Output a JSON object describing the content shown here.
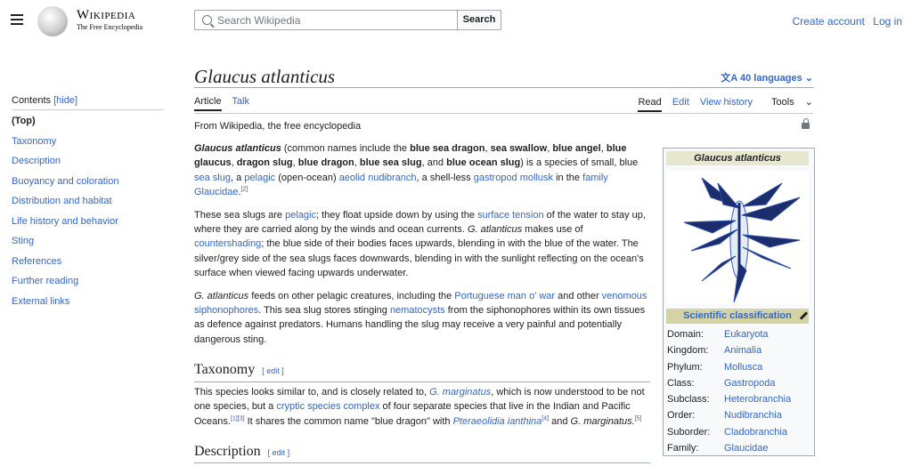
{
  "header": {
    "logo": {
      "wordmark": "Wikipedia",
      "tagline": "The Free Encyclopedia"
    },
    "search": {
      "placeholder": "Search Wikipedia",
      "button": "Search"
    },
    "user_links": [
      "Create account",
      "Log in"
    ]
  },
  "toc": {
    "title": "Contents",
    "hide_label": "[hide]",
    "items": [
      "(Top)",
      "Taxonomy",
      "Description",
      "Buoyancy and coloration",
      "Distribution and habitat",
      "Life history and behavior",
      "Sting",
      "References",
      "Further reading",
      "External links"
    ]
  },
  "article": {
    "title": "Glaucus atlanticus",
    "languages": "40 languages",
    "tabs": [
      "Article",
      "Talk"
    ],
    "view_tabs": [
      "Read",
      "Edit",
      "View history",
      "Tools"
    ],
    "from": "From Wikipedia, the free encyclopedia",
    "p1": {
      "sci": "Glaucus atlanticus",
      "a": " (common names include the ",
      "b1": "blue sea dragon",
      "c1": ", ",
      "b2": "sea swallow",
      "c2": ", ",
      "b3": "blue angel",
      "c3": ", ",
      "b4": "blue glaucus",
      "c4": ", ",
      "b5": "dragon slug",
      "c5": ", ",
      "b6": "blue dragon",
      "c6": ", ",
      "b7": "blue sea slug",
      "c7": ", and ",
      "b8": "blue ocean slug",
      "c8": ") is a species of small, blue ",
      "l1": "sea slug",
      "c9": ", a ",
      "l2": "pelagic",
      "c10": " (open-ocean) ",
      "l3": "aeolid nudibranch",
      "c11": ", a shell-less ",
      "l4": "gastropod mollusk",
      "c12": " in the ",
      "l5": "family Glaucidae",
      "c13": ".",
      "ref": "[2]"
    },
    "p2": {
      "a": "These sea slugs are ",
      "l1": "pelagic",
      "b": "; they float upside down by using the ",
      "l2": "surface tension",
      "c": " of the water to stay up, where they are carried along by the winds and ocean currents. ",
      "i1": "G. atlanticus",
      "d": " makes use of ",
      "l3": "countershading",
      "e": "; the blue side of their bodies faces upwards, blending in with the blue of the water. The silver/grey side of the sea slugs faces downwards, blending in with the sunlight reflecting on the ocean's surface when viewed facing upwards underwater."
    },
    "p3": {
      "i1": "G. atlanticus",
      "a": " feeds on other pelagic creatures, including the ",
      "l1": "Portuguese man o' war",
      "b": " and other ",
      "l2": "venomous siphonophores",
      "c": ". This sea slug stores stinging ",
      "l3": "nematocysts",
      "d": " from the siphonophores within its own tissues as defence against predators. Humans handling the slug may receive a very painful and potentially dangerous sting."
    },
    "h_taxonomy": "Taxonomy",
    "edit_label": "[ edit ]",
    "p4": {
      "a": "This species looks similar to, and is closely related to, ",
      "i1": "G. marginatus",
      "b": ", which is now understood to be not one species, but a ",
      "l1": "cryptic species complex",
      "c": " of four separate species that live in the Indian and Pacific Oceans.",
      "r1": "[1][3]",
      "d": " It shares the common name \"blue dragon\" with ",
      "i2": "Pteraeolidia ianthina",
      "r2": "[4]",
      "e": " and ",
      "i3": "G. marginatus.",
      "r3": "[5]"
    },
    "h_description": "Description"
  },
  "infobox": {
    "title": "Glaucus atlanticus",
    "sci_label": "Scientific classification",
    "rows": [
      {
        "k": "Domain:",
        "v": "Eukaryota"
      },
      {
        "k": "Kingdom:",
        "v": "Animalia"
      },
      {
        "k": "Phylum:",
        "v": "Mollusca"
      },
      {
        "k": "Class:",
        "v": "Gastropoda"
      },
      {
        "k": "Subclass:",
        "v": "Heterobranchia"
      },
      {
        "k": "Order:",
        "v": "Nudibranchia"
      },
      {
        "k": "Suborder:",
        "v": "Cladobranchia"
      },
      {
        "k": "Family:",
        "v": "Glaucidae"
      }
    ]
  },
  "colors": {
    "link": "#3366cc",
    "text": "#202122",
    "border": "#a2a9b1"
  }
}
